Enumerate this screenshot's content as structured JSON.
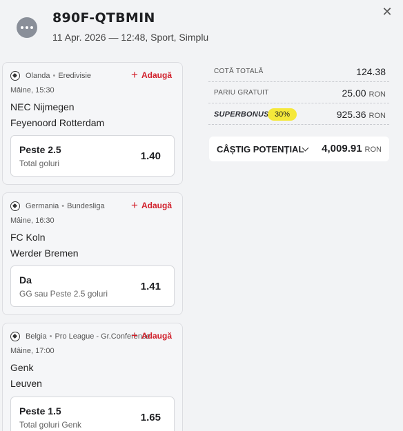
{
  "header": {
    "ticket_id": "890F-QTBMIN",
    "meta": "11 Apr. 2026 — 12:48, Sport, Simplu",
    "close_label": "✕",
    "more_icon": "more-dots-icon"
  },
  "events": [
    {
      "league": "Olanda",
      "competition": "Eredivisie",
      "add_label": "Adaugă",
      "time": "Mâine, 15:30",
      "home": "NEC Nijmegen",
      "away": "Feyenoord Rotterdam",
      "pick": "Peste 2.5",
      "market": "Total goluri",
      "odd": "1.40"
    },
    {
      "league": "Germania",
      "competition": "Bundesliga",
      "add_label": "Adaugă",
      "time": "Mâine, 16:30",
      "home": "FC Koln",
      "away": "Werder Bremen",
      "pick": "Da",
      "market": "GG sau Peste 2.5 goluri",
      "odd": "1.41"
    },
    {
      "league": "Belgia",
      "competition": "Pro League - Gr.Conference",
      "add_label": "Adaugă",
      "time": "Mâine, 17:00",
      "home": "Genk",
      "away": "Leuven",
      "pick": "Peste 1.5",
      "market": "Total goluri Genk",
      "odd": "1.65"
    }
  ],
  "summary": {
    "total_odds_label": "COTĂ TOTALĂ",
    "total_odds": "124.38",
    "free_bet_label": "PARIU GRATUIT",
    "free_bet": "25.00",
    "currency": "RON",
    "superbonus_label": "SUPERBONUS",
    "superbonus_pct": "30%",
    "superbonus_value": "925.36",
    "potential_win_label": "CÂȘTIG POTENȚIAL",
    "potential_win": "4,009.91"
  },
  "colors": {
    "accent_red": "#d11f2a",
    "badge_yellow": "#f5e83a",
    "background": "#f2f3f5"
  }
}
